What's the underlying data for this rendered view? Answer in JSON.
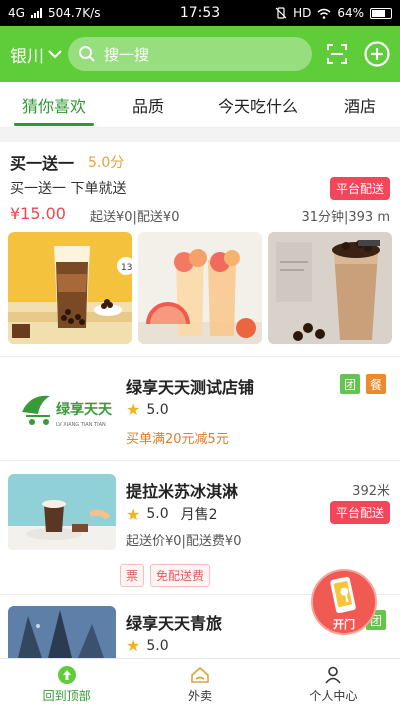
{
  "status_bar": {
    "network": "4G",
    "speed": "504.7K/s",
    "time": "17:53",
    "hd": "HD",
    "battery": "64%"
  },
  "header": {
    "city": "银川",
    "search_placeholder": "搜一搜"
  },
  "tabs": [
    "猜你喜欢",
    "品质",
    "今天吃什么",
    "酒店"
  ],
  "shops": [
    {
      "name": "买一送一",
      "score": "5.0分",
      "desc": "买一送一 下单就送",
      "badge": "平台配送",
      "price": "¥15.00",
      "fees": "起送¥0|配送¥0",
      "time_distance": "31分钟|393 m",
      "photo_badge": "13"
    },
    {
      "name": "绿享天天测试店铺",
      "logo_text": "绿享天天",
      "logo_sub": "LV XIANG TIAN TIAN",
      "rating": "5.0",
      "promo": "买单满20元减5元",
      "tag1": "团",
      "tag2": "餐"
    },
    {
      "name": "提拉米苏冰淇淋",
      "distance": "392米",
      "rating": "5.0",
      "monthly_sales": "月售2",
      "fees": "起送价¥0|配送费¥0",
      "badge": "平台配送",
      "chip1": "票",
      "chip2": "免配送费"
    },
    {
      "name": "绿享天天青旅",
      "rating": "5.0",
      "tag1": "团"
    }
  ],
  "float_button": {
    "label": "开门"
  },
  "bottom_nav": [
    {
      "label": "回到顶部",
      "icon": "arrow-up-icon"
    },
    {
      "label": "外卖",
      "icon": "house-icon"
    },
    {
      "label": "个人中心",
      "icon": "person-icon"
    }
  ],
  "colors": {
    "brand_green": "#5fcc3a",
    "active_green": "#2e9a2e",
    "badge_red": "#f0475a",
    "price_red": "#f0474f",
    "promo_orange": "#e07b28",
    "star_yellow": "#f2b21b"
  }
}
